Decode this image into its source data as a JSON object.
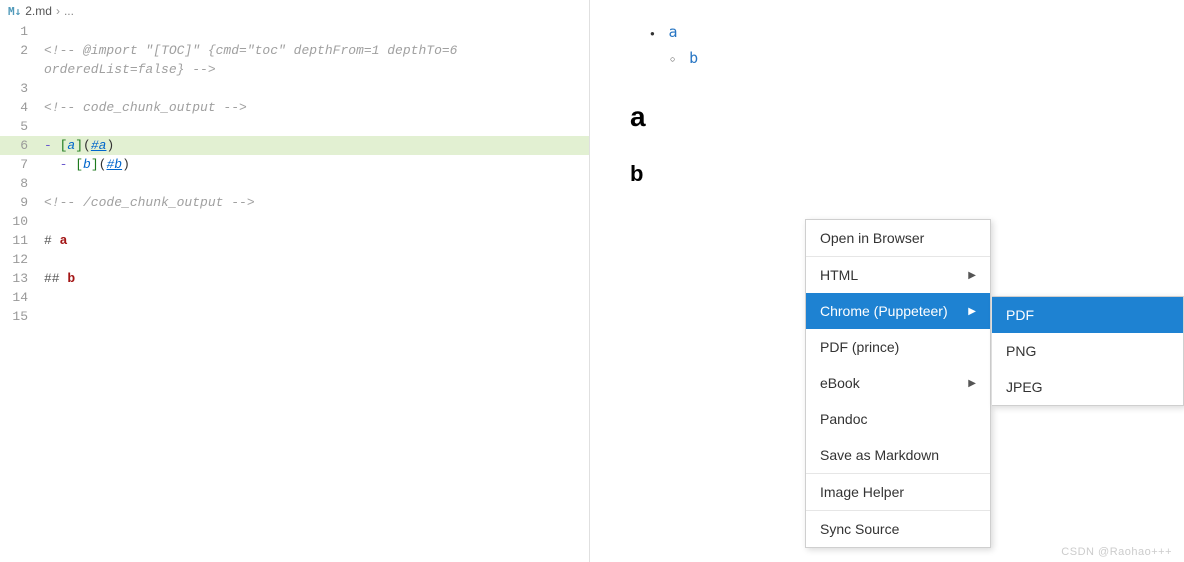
{
  "breadcrumb": {
    "icon": "M↓",
    "file": "2.md",
    "sep": "›",
    "rest": "..."
  },
  "lines": [
    {
      "n": 1,
      "segs": []
    },
    {
      "n": 2,
      "segs": [
        {
          "t": "<!-- @import \"[TOC]\" {cmd=\"toc\" depthFrom=1 depthTo=6 ",
          "cls": "c-comment"
        }
      ]
    },
    {
      "n": "",
      "segs": [
        {
          "t": "orderedList=false} -->",
          "cls": "c-comment"
        }
      ]
    },
    {
      "n": 3,
      "segs": []
    },
    {
      "n": 4,
      "segs": [
        {
          "t": "<!-- code_chunk_output -->",
          "cls": "c-comment"
        }
      ]
    },
    {
      "n": 5,
      "segs": []
    },
    {
      "n": 6,
      "hl": true,
      "segs": [
        {
          "t": "- ",
          "cls": "c-dash"
        },
        {
          "t": "[",
          "cls": "c-bracket"
        },
        {
          "t": "a",
          "cls": "c-text"
        },
        {
          "t": "]",
          "cls": "c-bracket"
        },
        {
          "t": "(",
          "cls": "c-paren"
        },
        {
          "t": "#a",
          "cls": "c-link"
        },
        {
          "t": ")",
          "cls": "c-paren"
        }
      ]
    },
    {
      "n": 7,
      "segs": [
        {
          "t": "  - ",
          "cls": "c-dash"
        },
        {
          "t": "[",
          "cls": "c-bracket"
        },
        {
          "t": "b",
          "cls": "c-text"
        },
        {
          "t": "]",
          "cls": "c-bracket"
        },
        {
          "t": "(",
          "cls": "c-paren"
        },
        {
          "t": "#b",
          "cls": "c-link"
        },
        {
          "t": ")",
          "cls": "c-paren"
        }
      ]
    },
    {
      "n": 8,
      "segs": []
    },
    {
      "n": 9,
      "segs": [
        {
          "t": "<!-- /code_chunk_output -->",
          "cls": "c-comment"
        }
      ]
    },
    {
      "n": 10,
      "segs": []
    },
    {
      "n": 11,
      "segs": [
        {
          "t": "# ",
          "cls": "c-hash"
        },
        {
          "t": "a",
          "cls": "c-head"
        }
      ]
    },
    {
      "n": 12,
      "segs": []
    },
    {
      "n": 13,
      "segs": [
        {
          "t": "## ",
          "cls": "c-hash"
        },
        {
          "t": "b",
          "cls": "c-head"
        }
      ]
    },
    {
      "n": 14,
      "segs": []
    },
    {
      "n": 15,
      "segs": []
    }
  ],
  "preview": {
    "toc": {
      "a": "a",
      "b": "b"
    },
    "h1": "a",
    "h2": "b"
  },
  "menu1": [
    {
      "label": "Open in Browser",
      "sub": false
    },
    {
      "sep": true
    },
    {
      "label": "HTML",
      "sub": true
    },
    {
      "label": "Chrome (Puppeteer)",
      "sub": true,
      "sel": true
    },
    {
      "label": "PDF (prince)",
      "sub": false
    },
    {
      "label": "eBook",
      "sub": true
    },
    {
      "label": "Pandoc",
      "sub": false
    },
    {
      "label": "Save as Markdown",
      "sub": false
    },
    {
      "sep": true
    },
    {
      "label": "Image Helper",
      "sub": false
    },
    {
      "sep": true
    },
    {
      "label": "Sync Source",
      "sub": false
    }
  ],
  "menu2": [
    {
      "label": "PDF",
      "sel": true
    },
    {
      "label": "PNG"
    },
    {
      "label": "JPEG"
    }
  ],
  "watermark": "CSDN @Raohao+++"
}
